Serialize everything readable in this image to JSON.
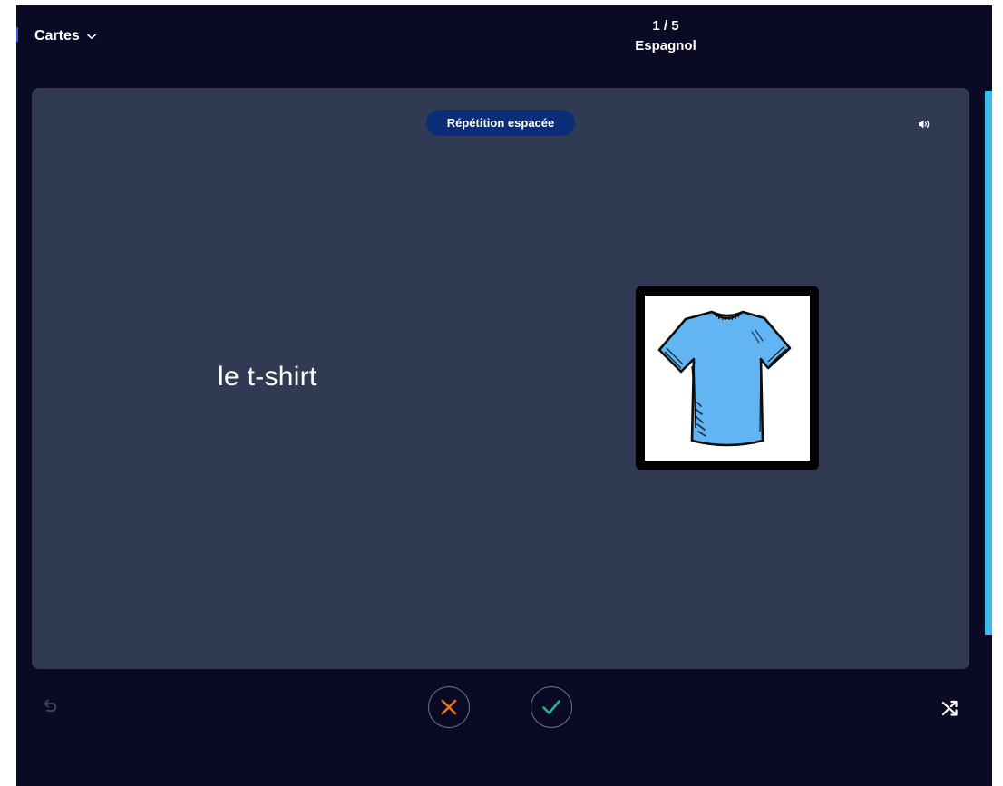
{
  "header": {
    "menu_label": "Cartes",
    "progress": "1 / 5",
    "set_title": "Espagnol"
  },
  "card": {
    "mode_badge": "Répétition espacée",
    "term": "le t-shirt",
    "image_subject": "t-shirt"
  },
  "icons": {
    "menu": "chevron-down-icon",
    "audio": "speaker-icon",
    "undo": "undo-icon",
    "wrong": "x-icon",
    "right": "check-icon",
    "shuffle": "shuffle-icon"
  },
  "colors": {
    "page_background": "#0a0a24",
    "card_background": "#303a52",
    "badge_background": "#0b2d78",
    "wrong_color": "#e8731f",
    "right_color": "#23b58a",
    "scroll_accent": "#39bdf0",
    "shirt_blue": "#62b4f2"
  }
}
